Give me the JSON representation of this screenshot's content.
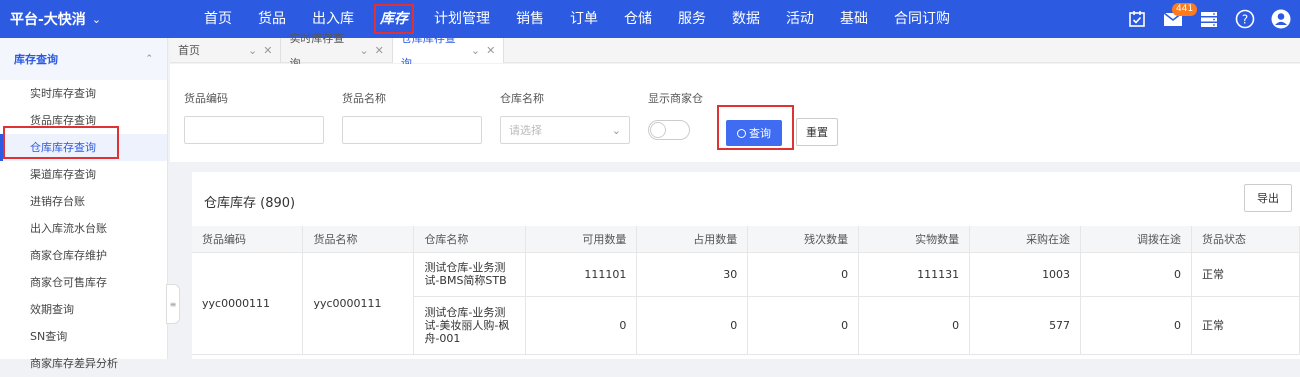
{
  "header": {
    "brand": "平台-大快消",
    "nav": [
      "首页",
      "货品",
      "出入库",
      "库存",
      "计划管理",
      "销售",
      "订单",
      "仓储",
      "服务",
      "数据",
      "活动",
      "基础",
      "合同订购"
    ],
    "active_nav": "库存",
    "mail_badge": "441",
    "icons": [
      "task-check-icon",
      "mail-icon",
      "storage-icon",
      "help-icon",
      "user-icon"
    ]
  },
  "sidebar": {
    "section": "库存查询",
    "items": [
      "实时库存查询",
      "货品库存查询",
      "仓库库存查询",
      "渠道库存查询",
      "进销存台账",
      "出入库流水台账",
      "商家仓库存维护",
      "商家仓可售库存",
      "效期查询",
      "SN查询",
      "商家库存差异分析"
    ],
    "active": "仓库库存查询"
  },
  "tabs": [
    {
      "label": "首页"
    },
    {
      "label": "实时库存查询"
    },
    {
      "label": "仓库库存查询"
    }
  ],
  "filter": {
    "goods_code_label": "货品编码",
    "goods_name_label": "货品名称",
    "warehouse_label": "仓库名称",
    "warehouse_placeholder": "请选择",
    "merchant_label": "显示商家仓",
    "query_button": "查询",
    "reset_button": "重置"
  },
  "table": {
    "title": "仓库库存 (890)",
    "export_button": "导出",
    "columns": [
      "货品编码",
      "货品名称",
      "仓库名称",
      "可用数量",
      "占用数量",
      "残次数量",
      "实物数量",
      "采购在途",
      "调拨在途",
      "货品状态"
    ],
    "goods_code": "yyc0000111",
    "goods_name": "yyc0000111",
    "rows": [
      {
        "warehouse": "测试仓库-业务测试-BMS简称STB",
        "available": "111101",
        "occupied": "30",
        "defective": "0",
        "physical": "111131",
        "purchase_transit": "1003",
        "transfer_transit": "0",
        "status": "正常"
      },
      {
        "warehouse": "测试仓库-业务测试-美妆丽人购-枫舟-001",
        "available": "0",
        "occupied": "0",
        "defective": "0",
        "physical": "0",
        "purchase_transit": "577",
        "transfer_transit": "0",
        "status": "正常"
      }
    ]
  },
  "colors": {
    "primary": "#2c5be2",
    "highlight": "#e03232",
    "badge": "#ff7a1a"
  }
}
